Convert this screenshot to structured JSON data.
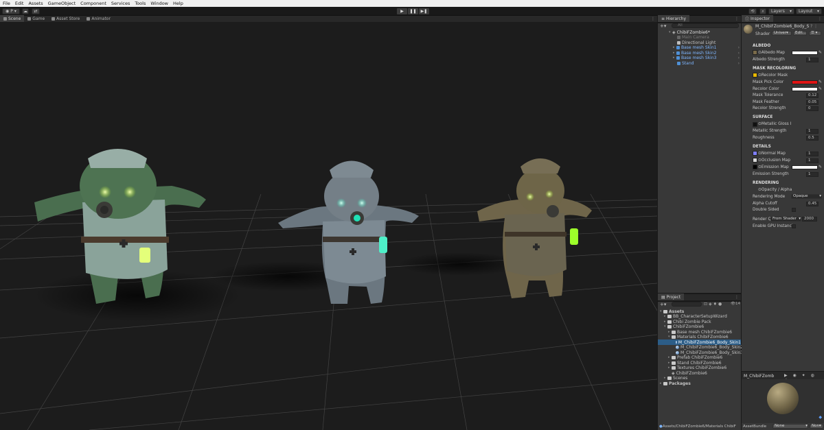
{
  "menu": [
    "File",
    "Edit",
    "Assets",
    "GameObject",
    "Component",
    "Services",
    "Tools",
    "Window",
    "Help"
  ],
  "toolbar": {
    "account_label": "P",
    "layers_label": "Layers",
    "layout_label": "Layout"
  },
  "scene_tabs": [
    "Scene",
    "Game",
    "Asset Store",
    "Animator"
  ],
  "hierarchy": {
    "tab_label": "Hierarchy",
    "search_placeholder": "All",
    "root": "ChibiFZombie6*",
    "items": [
      "Main Camera",
      "Directional Light",
      "Base mesh Skin1",
      "Base mesh Skin2",
      "Base mesh Skin3",
      "Stand"
    ]
  },
  "project": {
    "tab_label": "Project",
    "count": "14",
    "assets_label": "Assets",
    "items": [
      "BB_CharacterSetupWizard",
      "Chibi Zombie Pack",
      "ChibiFZombie6",
      "Base mesh ChibiFZombie6",
      "Materials ChibiFZombie6",
      "M_ChibiFZombie6_Body_Skin1",
      "M_ChibiFZombie6_Body_Skin2",
      "M_ChibiFZombie6_Body_Skin3",
      "Prefab ChibiFZombie6",
      "Stand ChibiFZombie6",
      "Textures ChibiFZombie6",
      "ChibiFZombie6",
      "Scenes"
    ],
    "packages_label": "Packages",
    "path": "Assets/ChibiFZombie6/Materials ChibiF"
  },
  "inspector": {
    "tab_label": "Inspector",
    "material_name": "M_ChibiFZombie6_Body_S",
    "shader_label": "Shader",
    "shader_value": "Univer",
    "edit_label": "Edit...",
    "sections": {
      "albedo": "ALBEDO",
      "mask": "MASK RECOLORING",
      "surface": "SURFACE",
      "details": "DETAILS",
      "rendering": "RENDERING"
    },
    "albedo_map": "Albedo Map",
    "albedo_strength": "Albedo Strength",
    "albedo_strength_val": "1",
    "recolor_mask": "Recolor Mask",
    "mask_pick_color": "Mask Pick Color",
    "recolor_color": "Recolor Color",
    "mask_tolerance": "Mask Tolerance",
    "mask_tolerance_val": "0.12",
    "mask_feather": "Mask Feather",
    "mask_feather_val": "0.05",
    "recolor_strength": "Recolor Strength",
    "recolor_strength_val": "0",
    "metallic_gloss": "Metallic Gloss I",
    "metallic_strength": "Metallic Strength",
    "metallic_strength_val": "1",
    "roughness": "Roughness",
    "roughness_val": "0.5",
    "normal_map": "Normal Map",
    "normal_map_val": "1",
    "occlusion_map": "Occlusion Map",
    "occlusion_map_val": "1",
    "emission_map": "Emission Map",
    "emission_strength": "Emission Strength",
    "emission_strength_val": "1",
    "opacity_alpha": "Opacity / Alpha",
    "rendering_mode": "Rendering Mode",
    "rendering_mode_val": "Opaque",
    "alpha_cutoff": "Alpha Cutoff",
    "alpha_cutoff_val": "0.45",
    "double_sided": "Double Sided",
    "render_queue": "Render Q",
    "render_queue_dd": "From Shader",
    "render_queue_val": "2000",
    "gpu_instancing": "Enable GPU Instanci",
    "preview_name": "M_ChibiFZomb",
    "assetbundle_label": "AssetBundle",
    "assetbundle_val": "None",
    "assetbundle_variant": "Non"
  },
  "colors": {
    "mask_pick": "#e01414",
    "recolor": "#ffffff",
    "selection": "#2c5d87",
    "link_blue": "#7eb6ff"
  }
}
